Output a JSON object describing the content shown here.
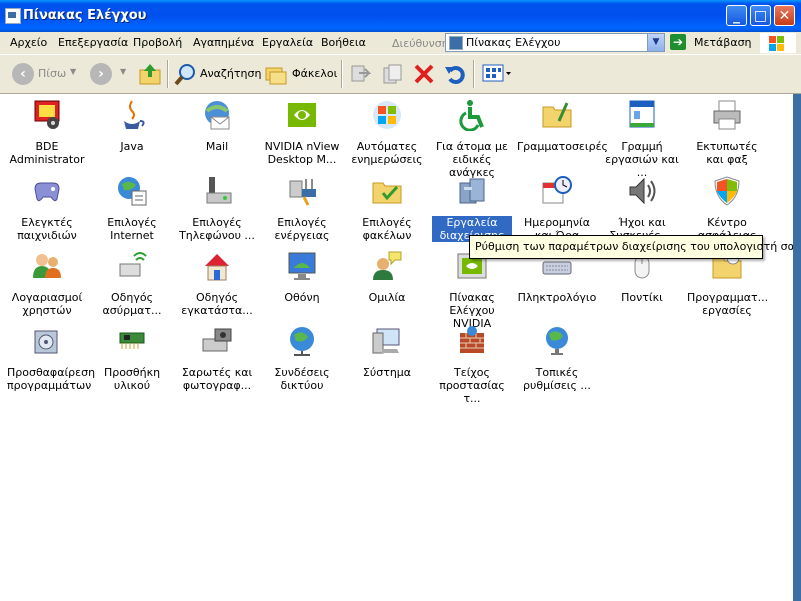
{
  "window": {
    "title": "Πίνακας Ελέγχου",
    "minimize": "_",
    "maximize": "□",
    "close": "✕"
  },
  "menu": [
    "Αρχείο",
    "Επεξεργασία",
    "Προβολή",
    "Αγαπημένα",
    "Εργαλεία",
    "Βοήθεια"
  ],
  "address": {
    "label": "Διεύθυνση",
    "value": "Πίνακας Ελέγχου",
    "go_label": "Μετάβαση"
  },
  "toolbar": {
    "back_label": "Πίσω",
    "search_label": "Αναζήτηση",
    "folders_label": "Φάκελοι"
  },
  "items": [
    {
      "label": "BDE Administrator",
      "icon": "bde-icon"
    },
    {
      "label": "Java",
      "icon": "java-icon"
    },
    {
      "label": "Mail",
      "icon": "mail-icon"
    },
    {
      "label": "NVIDIA nView Desktop M...",
      "icon": "nvidia-icon"
    },
    {
      "label": "Αυτόματες ενημερώσεις",
      "icon": "windows-update-icon"
    },
    {
      "label": "Για άτομα με ειδικές ανάγκες",
      "icon": "accessibility-icon"
    },
    {
      "label": "Γραμματοσειρές",
      "icon": "fonts-folder-icon"
    },
    {
      "label": "Γραμμή εργασιών και ...",
      "icon": "taskbar-icon"
    },
    {
      "label": "Εκτυπωτές και φαξ",
      "icon": "printer-icon"
    },
    {
      "label": "Ελεγκτές παιχνιδιών",
      "icon": "gamepad-icon"
    },
    {
      "label": "Επιλογές Internet",
      "icon": "internet-options-icon"
    },
    {
      "label": "Επιλογές Τηλεφώνου ...",
      "icon": "phone-modem-icon"
    },
    {
      "label": "Επιλογές ενέργειας",
      "icon": "power-options-icon"
    },
    {
      "label": "Επιλογές φακέλων",
      "icon": "folder-options-icon"
    },
    {
      "label": "Εργαλεία διαχείρισης",
      "icon": "admin-tools-icon"
    },
    {
      "label": "Ημερομηνία και Ώρα",
      "icon": "date-time-icon"
    },
    {
      "label": "Ήχοι και Συσκευές ...",
      "icon": "sounds-icon"
    },
    {
      "label": "Κέντρο ασφάλειας",
      "icon": "security-center-icon"
    },
    {
      "label": "Λογαριασμοί χρηστών",
      "icon": "user-accounts-icon"
    },
    {
      "label": "Οδηγός ασύρματ...",
      "icon": "wireless-wizard-icon"
    },
    {
      "label": "Οδηγός εγκατάστα...",
      "icon": "network-setup-icon"
    },
    {
      "label": "Οθόνη",
      "icon": "display-icon"
    },
    {
      "label": "Ομιλία",
      "icon": "speech-icon"
    },
    {
      "label": "Πίνακας Ελέγχου NVIDIA",
      "icon": "nvidia-control-icon"
    },
    {
      "label": "Πληκτρολόγιο",
      "icon": "keyboard-icon"
    },
    {
      "label": "Ποντίκι",
      "icon": "mouse-icon"
    },
    {
      "label": "Προγραμματ... εργασίες",
      "icon": "scheduled-tasks-icon"
    },
    {
      "label": "Προσθαφαίρεση προγραμμάτων",
      "icon": "add-remove-programs-icon"
    },
    {
      "label": "Προσθήκη υλικού",
      "icon": "add-hardware-icon"
    },
    {
      "label": "Σαρωτές και φωτογραφ...",
      "icon": "scanner-camera-icon"
    },
    {
      "label": "Συνδέσεις δικτύου",
      "icon": "network-connections-icon"
    },
    {
      "label": "Σύστημα",
      "icon": "system-icon"
    },
    {
      "label": "Τείχος προστασίας τ...",
      "icon": "firewall-icon"
    },
    {
      "label": "Τοπικές ρυθμίσεις ...",
      "icon": "regional-settings-icon"
    }
  ],
  "tooltip": "Ρύθμιση των παραμέτρων διαχείρισης του υπολογιστή σας.",
  "colors": {
    "titlebar": "#0053ee",
    "selection": "#316ac5",
    "chrome": "#ece9d8",
    "tooltip_bg": "#ffffe1"
  }
}
